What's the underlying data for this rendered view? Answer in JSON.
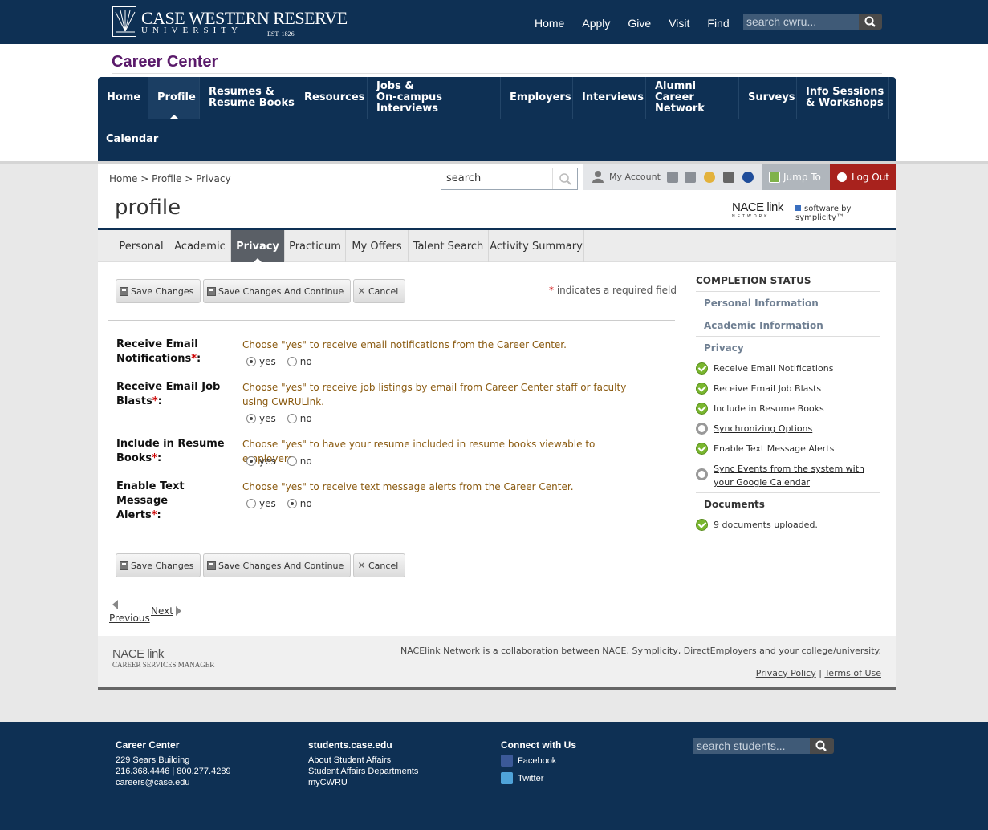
{
  "university": {
    "logo_name": "CASE WESTERN RESERVE",
    "logo_sub": "UNIVERSITY",
    "logo_est": "EST. 1826",
    "nav": [
      "Home",
      "Apply",
      "Give",
      "Visit",
      "Find"
    ],
    "search_placeholder": "search cwru..."
  },
  "site_title": "Career Center",
  "main_nav": [
    {
      "label": "Home"
    },
    {
      "label": "Profile"
    },
    {
      "label": "Resumes &\nResume Books"
    },
    {
      "label": "Resources"
    },
    {
      "label": "Jobs &\nOn-campus Interviews"
    },
    {
      "label": "Employers"
    },
    {
      "label": "Interviews"
    },
    {
      "label": "Alumni Career\nNetwork"
    },
    {
      "label": "Surveys"
    },
    {
      "label": "Info Sessions\n& Workshops"
    },
    {
      "label": "Calendar"
    }
  ],
  "breadcrumb": "Home > Profile > Privacy",
  "inner_search_value": "search",
  "toolbar": {
    "my_account": "My Account",
    "jump_to": "Jump To",
    "log_out": "Log Out"
  },
  "page_heading": "profile",
  "brand": {
    "nace_big": "NACE link",
    "nace_small": "NETWORK",
    "symplicity": "software by symplicity™"
  },
  "subtabs": [
    "Personal",
    "Academic",
    "Privacy",
    "Practicum",
    "My Offers",
    "Talent Search",
    "Activity Summary"
  ],
  "buttons": {
    "save": "Save Changes",
    "save_continue": "Save Changes And Continue",
    "cancel": "Cancel"
  },
  "required_note": "indicates a required field",
  "required_marker": "*",
  "form": [
    {
      "label_1": "Receive Email",
      "label_2": "Notifications",
      "help": "Choose \"yes\" to receive email notifications from the Career Center.",
      "selected": "yes"
    },
    {
      "label_1": "Receive Email Job",
      "label_2": "Blasts",
      "help": "Choose \"yes\" to receive job listings by email from Career Center staff or faculty using CWRULink.",
      "selected": "yes"
    },
    {
      "label_1": "Include in Resume",
      "label_2": "Books",
      "help": "Choose \"yes\" to have your resume included in resume books viewable to employers.",
      "selected": "yes"
    },
    {
      "label_1": "Enable Text Message",
      "label_2": "Alerts",
      "help": "Choose \"yes\" to receive text message alerts from the Career Center.",
      "selected": "no"
    }
  ],
  "radio_labels": {
    "yes": "yes",
    "no": "no"
  },
  "pager": {
    "previous": "Previous",
    "next": "Next"
  },
  "completion": {
    "title": "COMPLETION STATUS",
    "sections": [
      "Personal Information",
      "Academic Information",
      "Privacy"
    ],
    "items": [
      {
        "label": "Receive Email Notifications",
        "done": true
      },
      {
        "label": "Receive Email Job Blasts",
        "done": true
      },
      {
        "label": "Include in Resume Books",
        "done": true
      },
      {
        "label": "Synchronizing Options",
        "done": false
      },
      {
        "label": "Enable Text Message Alerts",
        "done": true
      },
      {
        "label": "Sync Events from the system with your Google Calendar",
        "done": false
      }
    ],
    "documents_title": "Documents",
    "documents_status": "9 documents uploaded."
  },
  "content_footer": {
    "logo_big": "NACE link",
    "logo_small": "CAREER SERVICES MANAGER",
    "collab": "NACElink Network is a collaboration between NACE, Symplicity, DirectEmployers and your college/university.",
    "privacy": "Privacy Policy",
    "terms": "Terms of Use",
    "separator": "|"
  },
  "site_footer": {
    "col1": {
      "heading": "Career Center",
      "lines": [
        "229 Sears Building",
        "216.368.4446 | 800.277.4289",
        "careers@case.edu"
      ]
    },
    "col2": {
      "heading": "students.case.edu",
      "lines": [
        "About Student Affairs",
        "Student Affairs Departments",
        "myCWRU"
      ]
    },
    "col3": {
      "heading": "Connect with Us",
      "facebook": "Facebook",
      "twitter": "Twitter"
    },
    "search_placeholder": "search students..."
  },
  "colors": {
    "navy": "#0e3054",
    "purple_title": "#5a1a6a",
    "logout_red": "#a8221d",
    "help_text": "#8a5a10",
    "check_green": "#79b62e"
  }
}
